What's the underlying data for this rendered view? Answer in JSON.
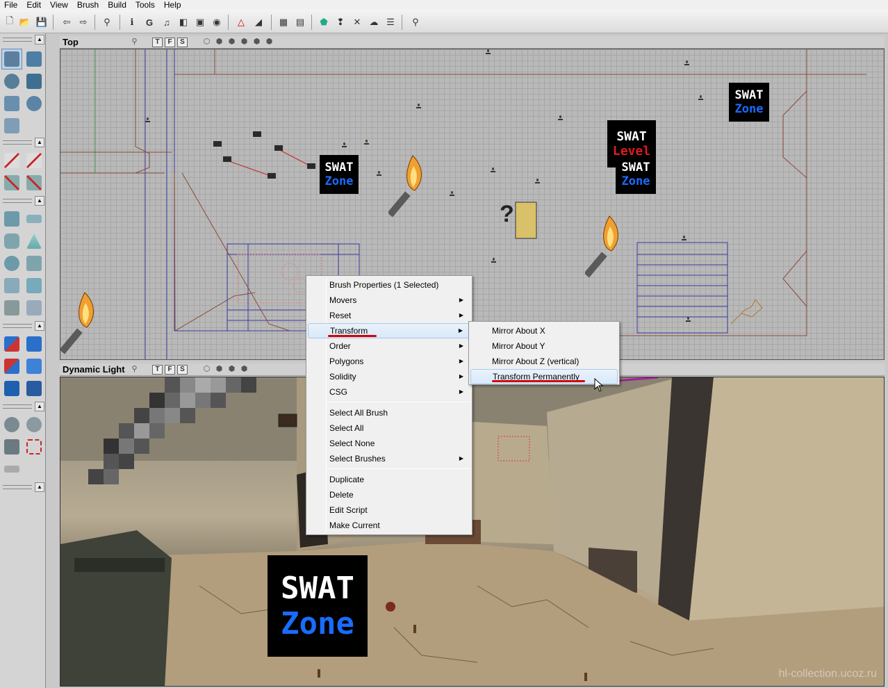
{
  "menubar": {
    "items": [
      "File",
      "Edit",
      "View",
      "Brush",
      "Build",
      "Tools",
      "Help"
    ]
  },
  "toolbar": {
    "icons": [
      "new-map-icon",
      "open-icon",
      "save-icon",
      "undo-icon",
      "redo-icon",
      "search-actors-icon",
      "actor-properties-icon",
      "group-browser-icon",
      "sound-browser-icon",
      "texture-browser-icon",
      "mesh-browser-icon",
      "build-geometry-icon",
      "build-lighting-icon",
      "build-paths-icon",
      "build-all-icon",
      "play-map-icon",
      "brush-builder-icon",
      "filter-icon",
      "options-icon",
      "actor-class-icon"
    ]
  },
  "top_view": {
    "title": "Top",
    "view_buttons": [
      "T",
      "F",
      "S"
    ],
    "swat_zones": [
      {
        "line1": "SWAT",
        "line2": "Zone"
      },
      {
        "line1": "SWAT",
        "line2": "Level"
      },
      {
        "line1": "SWAT",
        "line2": "Zone"
      },
      {
        "line1": "SWAT",
        "line2": "Zone"
      }
    ]
  },
  "dynamic_view": {
    "title": "Dynamic Light",
    "view_buttons": [
      "T",
      "F",
      "S"
    ],
    "swat_zone": {
      "line1": "SWAT",
      "line2": "Zone"
    },
    "watermark": "hl-collection.ucoz.ru"
  },
  "context_menu": {
    "items": [
      {
        "label": "Brush Properties (1 Selected)",
        "submenu": false
      },
      {
        "label": "Movers",
        "submenu": true
      },
      {
        "label": "Reset",
        "submenu": true
      },
      {
        "label": "Transform",
        "submenu": true
      },
      {
        "label": "Order",
        "submenu": true
      },
      {
        "label": "Polygons",
        "submenu": true
      },
      {
        "label": "Solidity",
        "submenu": true
      },
      {
        "label": "CSG",
        "submenu": true
      },
      {
        "label": "Select All Brush",
        "submenu": false
      },
      {
        "label": "Select All",
        "submenu": false
      },
      {
        "label": "Select None",
        "submenu": false
      },
      {
        "label": "Select Brushes",
        "submenu": true
      },
      {
        "label": "Duplicate",
        "submenu": false
      },
      {
        "label": "Delete",
        "submenu": false
      },
      {
        "label": "Edit Script",
        "submenu": false
      },
      {
        "label": "Make Current",
        "submenu": false
      }
    ],
    "highlighted": "Transform"
  },
  "transform_submenu": {
    "items": [
      "Mirror About X",
      "Mirror About Y",
      "Mirror About Z (vertical)",
      "Transform Permanently"
    ],
    "highlighted": "Transform Permanently"
  },
  "colors": {
    "highlight_underline": "#d40000",
    "swat_zone_blue": "#1a6cff",
    "swat_level_red": "#e01b1b"
  }
}
